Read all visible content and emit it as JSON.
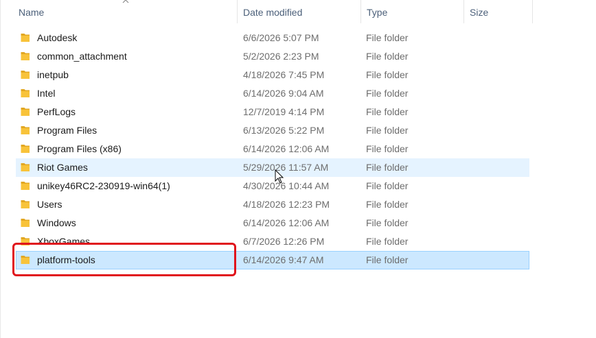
{
  "columns": {
    "name": "Name",
    "date_modified": "Date modified",
    "type": "Type",
    "size": "Size"
  },
  "sort": {
    "column": "name",
    "direction": "ascending",
    "icon": "chevron-up-icon"
  },
  "colors": {
    "folder": "#f8c33a",
    "folder_dark": "#e2a721",
    "hover_row": "#e5f3ff",
    "selected_row": "#cce8ff",
    "selected_border": "#99d1ff",
    "annotation_box": "#e0131b"
  },
  "files": [
    {
      "name": "Autodesk",
      "date": "6/6/2026 5:07 PM",
      "type": "File folder",
      "size": "",
      "state": "normal"
    },
    {
      "name": "common_attachment",
      "date": "5/2/2026 2:23 PM",
      "type": "File folder",
      "size": "",
      "state": "normal"
    },
    {
      "name": "inetpub",
      "date": "4/18/2026 7:45 PM",
      "type": "File folder",
      "size": "",
      "state": "normal"
    },
    {
      "name": "Intel",
      "date": "6/14/2026 9:04 AM",
      "type": "File folder",
      "size": "",
      "state": "normal"
    },
    {
      "name": "PerfLogs",
      "date": "12/7/2019 4:14 PM",
      "type": "File folder",
      "size": "",
      "state": "normal"
    },
    {
      "name": "Program Files",
      "date": "6/13/2026 5:22 PM",
      "type": "File folder",
      "size": "",
      "state": "normal"
    },
    {
      "name": "Program Files (x86)",
      "date": "6/14/2026 12:06 AM",
      "type": "File folder",
      "size": "",
      "state": "normal"
    },
    {
      "name": "Riot Games",
      "date": "5/29/2026 11:57 AM",
      "type": "File folder",
      "size": "",
      "state": "hover"
    },
    {
      "name": "unikey46RC2-230919-win64(1)",
      "date": "4/30/2026 10:44 AM",
      "type": "File folder",
      "size": "",
      "state": "normal"
    },
    {
      "name": "Users",
      "date": "4/18/2026 12:23 PM",
      "type": "File folder",
      "size": "",
      "state": "normal"
    },
    {
      "name": "Windows",
      "date": "6/14/2026 12:06 AM",
      "type": "File folder",
      "size": "",
      "state": "normal"
    },
    {
      "name": "XboxGames",
      "date": "6/7/2026 12:26 PM",
      "type": "File folder",
      "size": "",
      "state": "normal"
    },
    {
      "name": "platform-tools",
      "date": "6/14/2026 9:47 AM",
      "type": "File folder",
      "size": "",
      "state": "selected"
    }
  ],
  "annotation": {
    "target": "platform-tools",
    "shape": "rounded-rectangle"
  },
  "cursor": {
    "icon": "mouse-pointer-icon"
  }
}
